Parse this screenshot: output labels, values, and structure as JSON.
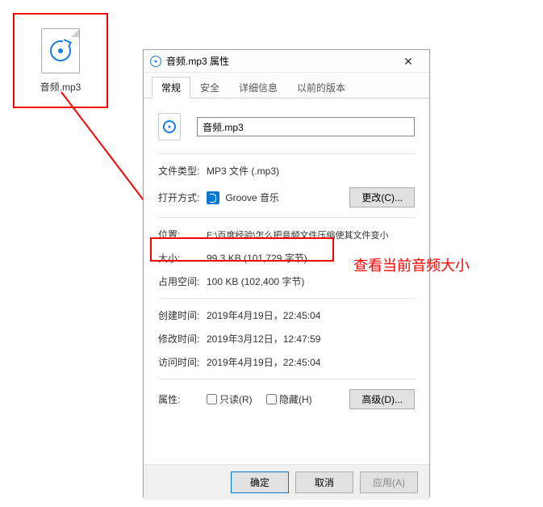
{
  "desktop": {
    "file_label": "音频.mp3"
  },
  "dialog": {
    "title": "音频.mp3 属性",
    "tabs": [
      "常规",
      "安全",
      "详细信息",
      "以前的版本"
    ],
    "filename": "音频.mp3",
    "fields": {
      "file_type_label": "文件类型:",
      "file_type_value": "MP3 文件 (.mp3)",
      "open_with_label": "打开方式:",
      "open_with_value": "Groove 音乐",
      "change_button": "更改(C)...",
      "location_label": "位置:",
      "location_value": "E:\\百度经验\\怎么把音频文件压缩使其文件变小",
      "size_label": "大小:",
      "size_value": "99.3 KB (101,729 字节)",
      "disk_size_label": "占用空间:",
      "disk_size_value": "100 KB (102,400 字节)",
      "created_label": "创建时间:",
      "created_value": "2019年4月19日，22:45:04",
      "modified_label": "修改时间:",
      "modified_value": "2019年3月12日，12:47:59",
      "accessed_label": "访问时间:",
      "accessed_value": "2019年4月19日，22:45:04",
      "attributes_label": "属性:",
      "readonly_label": "只读(R)",
      "hidden_label": "隐藏(H)",
      "advanced_button": "高级(D)..."
    },
    "buttons": {
      "ok": "确定",
      "cancel": "取消",
      "apply": "应用(A)"
    }
  },
  "annotation": {
    "text": "查看当前音频大小"
  }
}
